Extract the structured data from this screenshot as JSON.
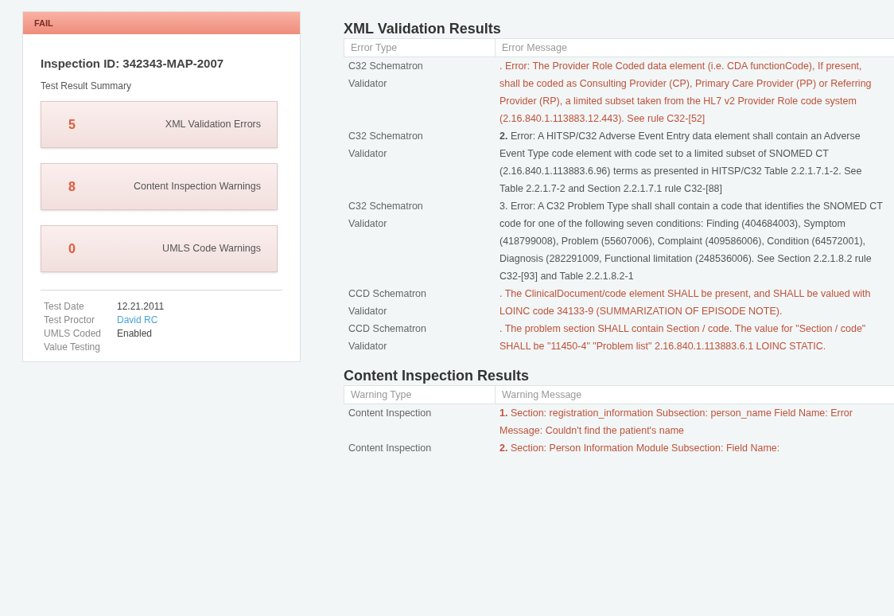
{
  "status": {
    "label": "FAIL",
    "passed": false
  },
  "inspection_id": "Inspection ID: 342343-MAP-2007",
  "summary_title": "Test Result Summary",
  "summary": [
    {
      "count": "5",
      "label": "XML Validation Errors"
    },
    {
      "count": "8",
      "label": "Content Inspection Warnings"
    },
    {
      "count": "0",
      "label": "UMLS Code Warnings"
    }
  ],
  "details": [
    {
      "label": "Test Date",
      "value": "12.21.2011",
      "link": false
    },
    {
      "label": "Test Proctor",
      "value": "David RC",
      "link": true
    },
    {
      "label": "UMLS Coded",
      "value": "Enabled",
      "link": false
    },
    {
      "label": "Value Testing"
    }
  ],
  "sections": [
    {
      "title": "XML Validation Results",
      "columns": [
        "Error Type",
        "Error Message"
      ],
      "rows": [
        {
          "type": "C32 Schematron Validator",
          "message": ". Error: The Provider Role Coded data element (i.e. CDA functionCode), If present, shall be coded as Consulting Provider (CP), Primary Care Provider (PP) or Referring Provider (RP), a limited subset taken from the HL7 v2 Provider Role code system (2.16.840.1.113883.12.443). See rule C32-[52]",
          "highlighted": true
        },
        {
          "type": "C32 Schematron Validator",
          "message": "**2.** Error: A HITSP/C32 Adverse Event Entry data element shall contain an Adverse Event Type code element with code set to a limited subset of SNOMED CT (2.16.840.1.113883.6.96) terms as presented in HITSP/C32 Table 2.2.1.7.1-2. See Table 2.2.1.7-2 and Section 2.2.1.7.1 rule C32-[88]",
          "highlighted": false
        },
        {
          "type": "C32 Schematron Validator",
          "message": "3. Error: A C32 Problem Type shall shall contain a code that identifies the SNOMED CT code for one of the following seven conditions: Finding (404684003), Symptom (418799008), Problem (55607006), Complaint (409586006), Condition (64572001), Diagnosis (282291009, Functional limitation (248536006). See Section 2.2.1.8.2 rule C32-[93] and Table 2.2.1.8.2-1",
          "highlighted": false
        },
        {
          "type": "CCD Schematron Validator",
          "message": ". The ClinicalDocument/code element SHALL be present, and SHALL be valued with LOINC code 34133-9 (SUMMARIZATION OF EPISODE NOTE).",
          "highlighted": true
        },
        {
          "type": "CCD Schematron Validator",
          "message": ". The problem section SHALL contain Section / code. The value for \"Section / code\" SHALL be \"11450-4\" \"Problem list\" 2.16.840.1.113883.6.1 LOINC STATIC.",
          "highlighted": true
        }
      ]
    },
    {
      "title": "Content Inspection Results",
      "columns": [
        "Warning Type",
        "Warning Message"
      ],
      "rows": [
        {
          "type": "Content Inspection",
          "message": "**1.** Section: registration_information Subsection: person_name Field Name: Error Message: Couldn't find the patient's name",
          "highlighted": true
        },
        {
          "type": "Content Inspection",
          "message": "**2.** Section: Person Information Module Subsection: Field Name:",
          "highlighted": true
        }
      ]
    }
  ]
}
